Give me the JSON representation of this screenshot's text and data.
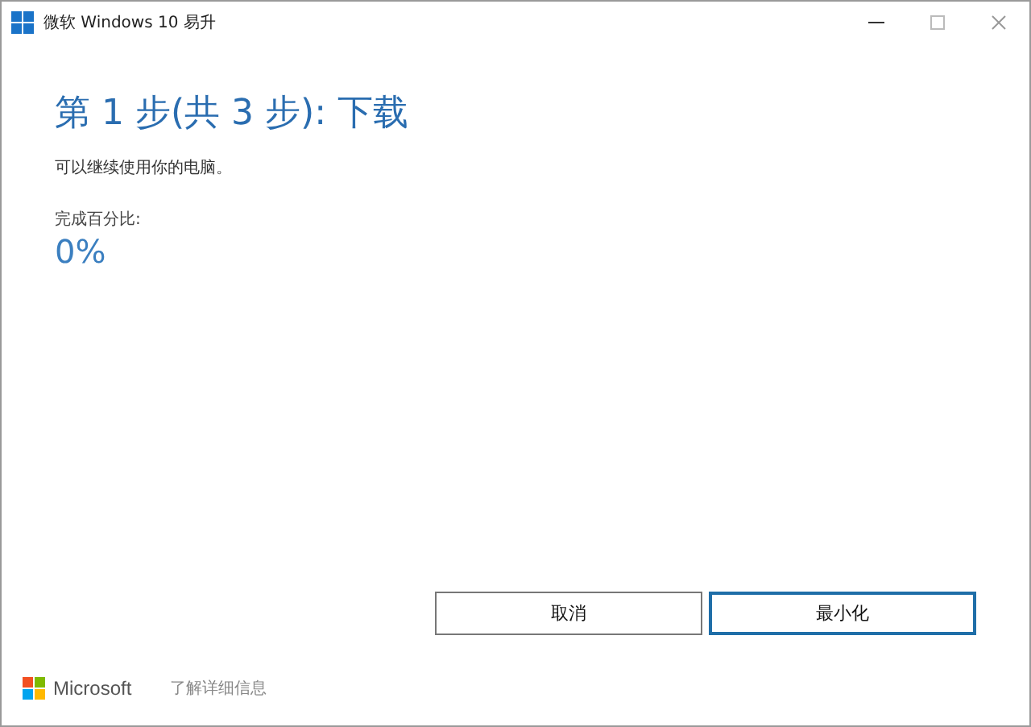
{
  "window": {
    "title": "微软 Windows 10 易升"
  },
  "heading": "第 1 步(共 3 步): 下载",
  "subtitle": "可以继续使用你的电脑。",
  "progress": {
    "label": "完成百分比:",
    "value": "0%"
  },
  "buttons": [
    {
      "label": "取消",
      "selected": false
    },
    {
      "label": "最小化",
      "selected": true
    }
  ],
  "footer": {
    "brand": "Microsoft",
    "link": "了解详细信息"
  }
}
